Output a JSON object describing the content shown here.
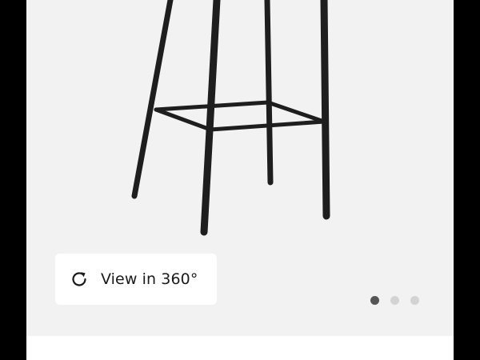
{
  "product_gallery": {
    "image_icon": "bar-stool-legs-image",
    "view_360": {
      "icon": "rotate-refresh-icon",
      "label": "View in 360°"
    },
    "carousel": {
      "total": 3,
      "active_index": 0
    }
  },
  "colors": {
    "background_frame": "#000000",
    "stage": "#f2f2f2",
    "button_bg": "#ffffff",
    "dot_active": "#555555",
    "dot_inactive": "#d3d3d3"
  }
}
